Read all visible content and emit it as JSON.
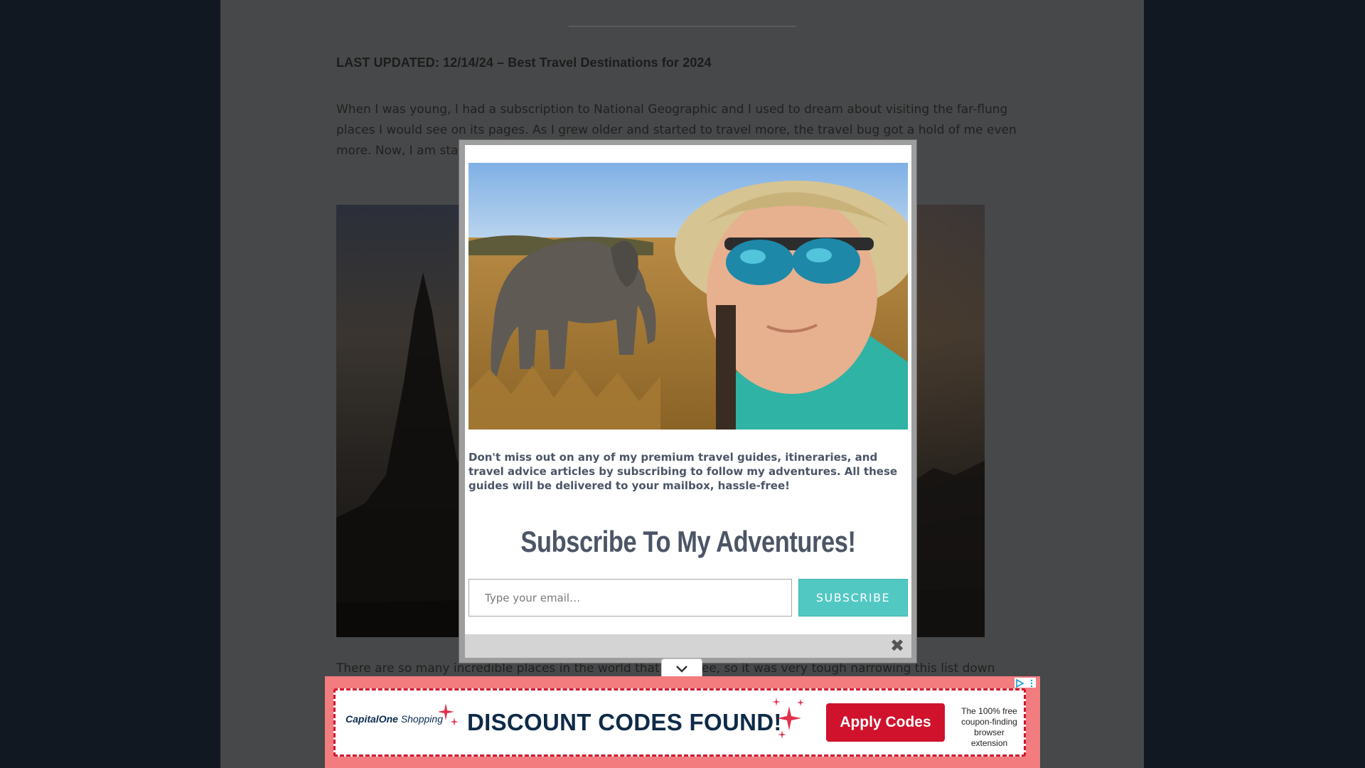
{
  "article": {
    "last_updated": "LAST UPDATED: 12/14/24 – Best Travel Destinations for 2024",
    "intro": "When I was young, I had a subscription to National Geographic and I used to dream about visiting the far-flung places I would see on its pages. As I grew older and started to travel more, the travel bug got a hold of me even more. Now, I am star… you. In this article, I am going to… you.",
    "after_image": "There are so many incredible places in the world that … to see, so it was very tough narrowing this list down"
  },
  "modal": {
    "description": "Don't miss out on any of my premium travel guides, itineraries, and travel advice articles by subscribing to follow my adventures. All these guides will be delivered to your mailbox, hassle-free!",
    "heading": "Subscribe To My Adventures!",
    "email_placeholder": "Type your email…",
    "subscribe_label": "SUBSCRIBE",
    "close_glyph": "✖"
  },
  "ad": {
    "logo_brand": "Capital",
    "logo_brand_rest": "One",
    "logo_product": "Shopping",
    "headline": "DISCOUNT CODES FOUND!",
    "button_label": "Apply Codes",
    "side_text": "The 100% free coupon-finding browser extension",
    "icons": [
      "adchoices-icon",
      "more-options-icon",
      "chevron-down-icon",
      "sparkle-icon"
    ]
  },
  "colors": {
    "page_background": "#121821",
    "content_background": "#474849",
    "subscribe_button": "#52c8c3",
    "ad_accent": "#d0122c"
  }
}
